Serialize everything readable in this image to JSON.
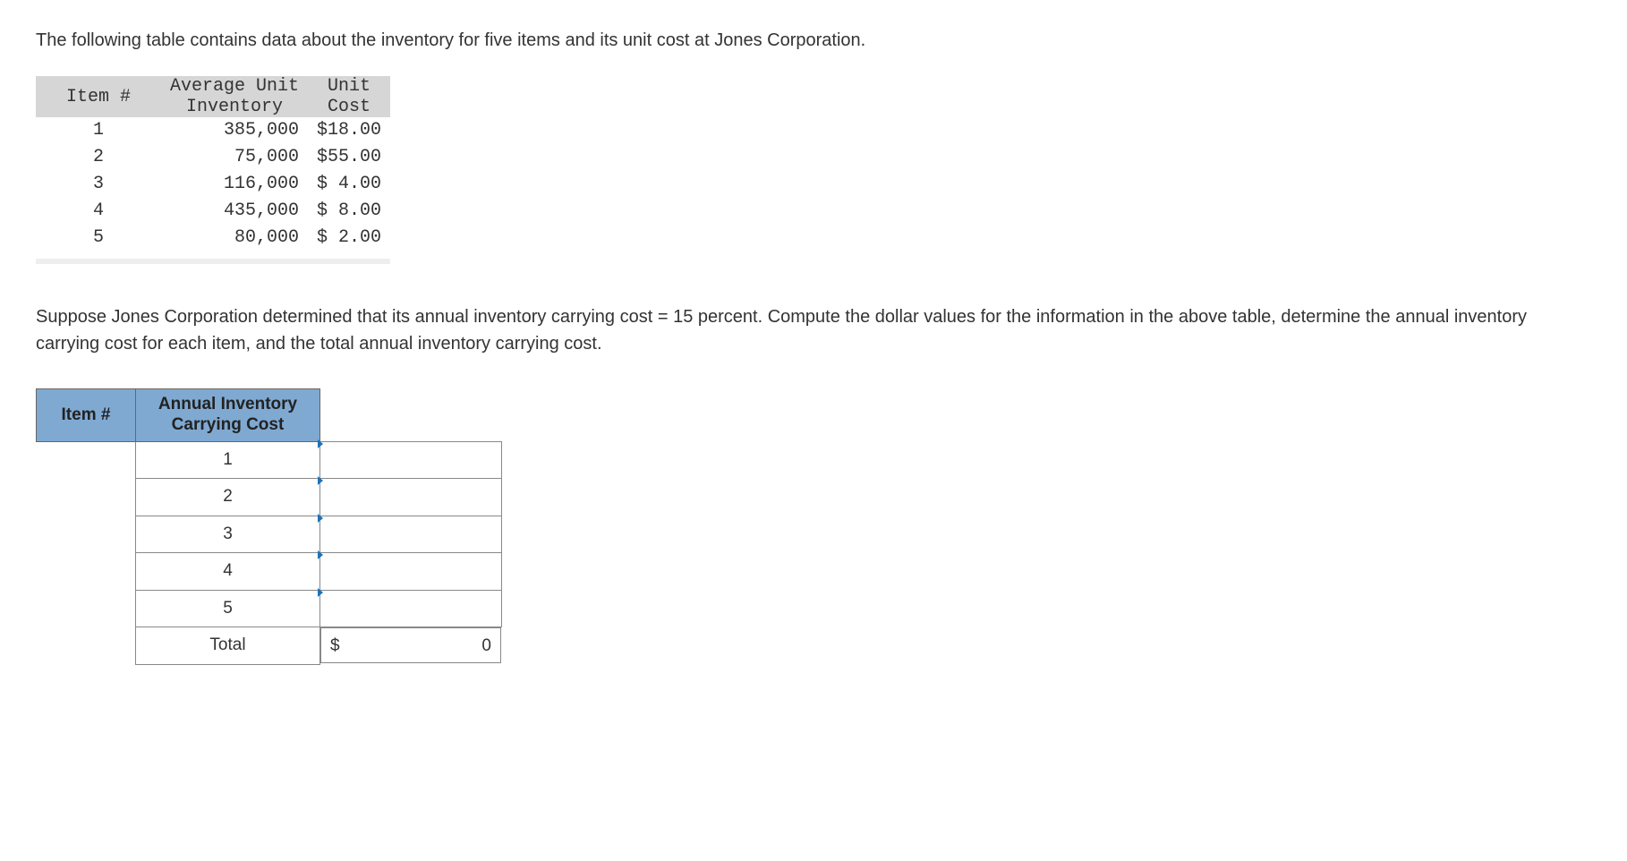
{
  "intro": "The following table contains data about the inventory for five items and its unit cost at Jones Corporation.",
  "data_table": {
    "headers": {
      "item": "Item #",
      "avg_line1": "Average Unit",
      "avg_line2": "Inventory",
      "cost_line1": "Unit",
      "cost_line2": "Cost"
    },
    "rows": [
      {
        "item": "1",
        "avg": "385,000",
        "cost": "$18.00"
      },
      {
        "item": "2",
        "avg": "75,000",
        "cost": "$55.00"
      },
      {
        "item": "3",
        "avg": "116,000",
        "cost": "$ 4.00"
      },
      {
        "item": "4",
        "avg": "435,000",
        "cost": "$ 8.00"
      },
      {
        "item": "5",
        "avg": "80,000",
        "cost": "$ 2.00"
      }
    ]
  },
  "question": "Suppose Jones Corporation determined that its annual inventory carrying cost = 15 percent. Compute the dollar values for the information in the above table, determine the annual inventory carrying cost for each item, and the total annual inventory carrying cost.",
  "answer_table": {
    "headers": {
      "item": "Item #",
      "cost": "Annual Inventory Carrying Cost"
    },
    "rows": [
      {
        "item": "1",
        "value": ""
      },
      {
        "item": "2",
        "value": ""
      },
      {
        "item": "3",
        "value": ""
      },
      {
        "item": "4",
        "value": ""
      },
      {
        "item": "5",
        "value": ""
      }
    ],
    "total_label": "Total",
    "total_currency": "$",
    "total_value": "0"
  },
  "chart_data": {
    "type": "table",
    "title": "Inventory data for five items at Jones Corporation",
    "columns": [
      "Item #",
      "Average Unit Inventory",
      "Unit Cost"
    ],
    "rows": [
      [
        1,
        385000,
        18.0
      ],
      [
        2,
        75000,
        55.0
      ],
      [
        3,
        116000,
        4.0
      ],
      [
        4,
        435000,
        8.0
      ],
      [
        5,
        80000,
        2.0
      ]
    ],
    "carrying_cost_rate_percent": 15
  }
}
